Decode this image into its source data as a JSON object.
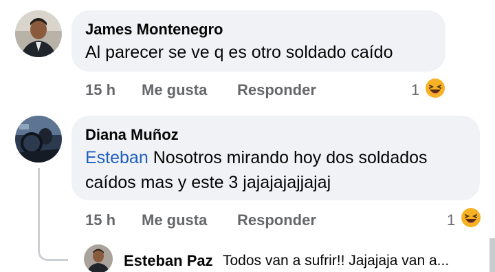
{
  "comments": [
    {
      "author": "James Montenegro",
      "text": "Al parecer se ve q es otro soldado caído",
      "time": "15 h",
      "like_label": "Me gusta",
      "reply_label": "Responder",
      "reaction_count": "1",
      "reaction_icon": "laughing-emoji-icon",
      "avatar_icon": "profile-photo-man-icon"
    },
    {
      "author": "Diana Muñoz",
      "mention": "Esteban",
      "text_line1": " Nosotros mirando hoy dos soldados",
      "text_line2": "caídos mas y este 3 jajajajajjajaj",
      "time": "15 h",
      "like_label": "Me gusta",
      "reply_label": "Responder",
      "reaction_count": "1",
      "reaction_icon": "laughing-emoji-icon",
      "avatar_icon": "profile-photo-car-icon"
    }
  ],
  "reply_preview": {
    "author": "Esteban Paz",
    "text": "Todos van a sufrir!! Jajajaja van a...",
    "avatar_icon": "profile-photo-man-icon"
  },
  "colors": {
    "bubble_bg": "#f0f2f5",
    "mention": "#1f5fbf",
    "secondary_text": "#65676b",
    "laugh_emoji": "#f7b125"
  }
}
